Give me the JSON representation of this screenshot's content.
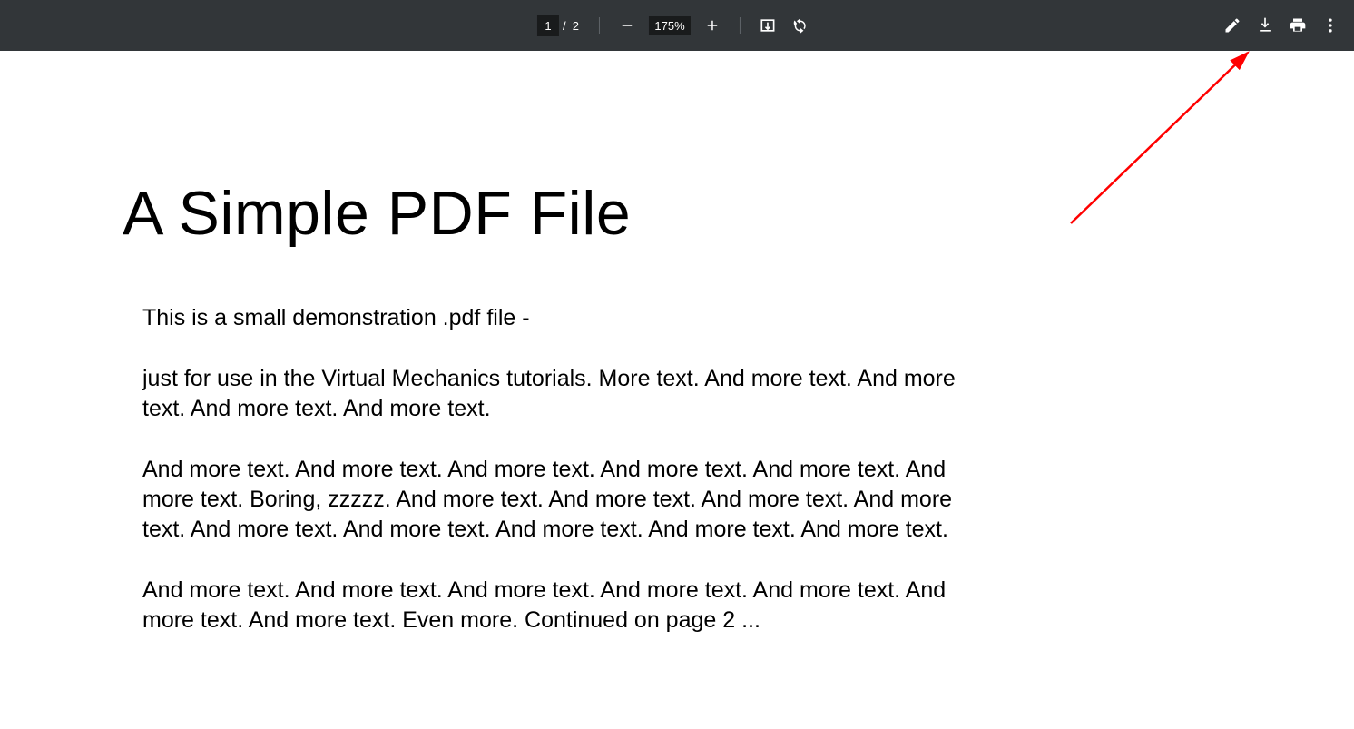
{
  "toolbar": {
    "page_current": "1",
    "page_total_label": "/  2",
    "zoom_label": "175%"
  },
  "document": {
    "title": "A Simple PDF File",
    "p1": "This is a small demonstration .pdf file -",
    "p2": "just for use in the Virtual Mechanics tutorials. More text. And more text. And more text. And more text. And more text.",
    "p3": "And more text. And more text. And more text. And more text. And more text. And more text. Boring, zzzzz. And more text. And more text. And more text. And more text. And more text. And more text. And more text. And more text. And more text.",
    "p4": "And more text. And more text. And more text. And more text. And more text. And more text. And more text. Even more. Continued on page 2 ..."
  }
}
